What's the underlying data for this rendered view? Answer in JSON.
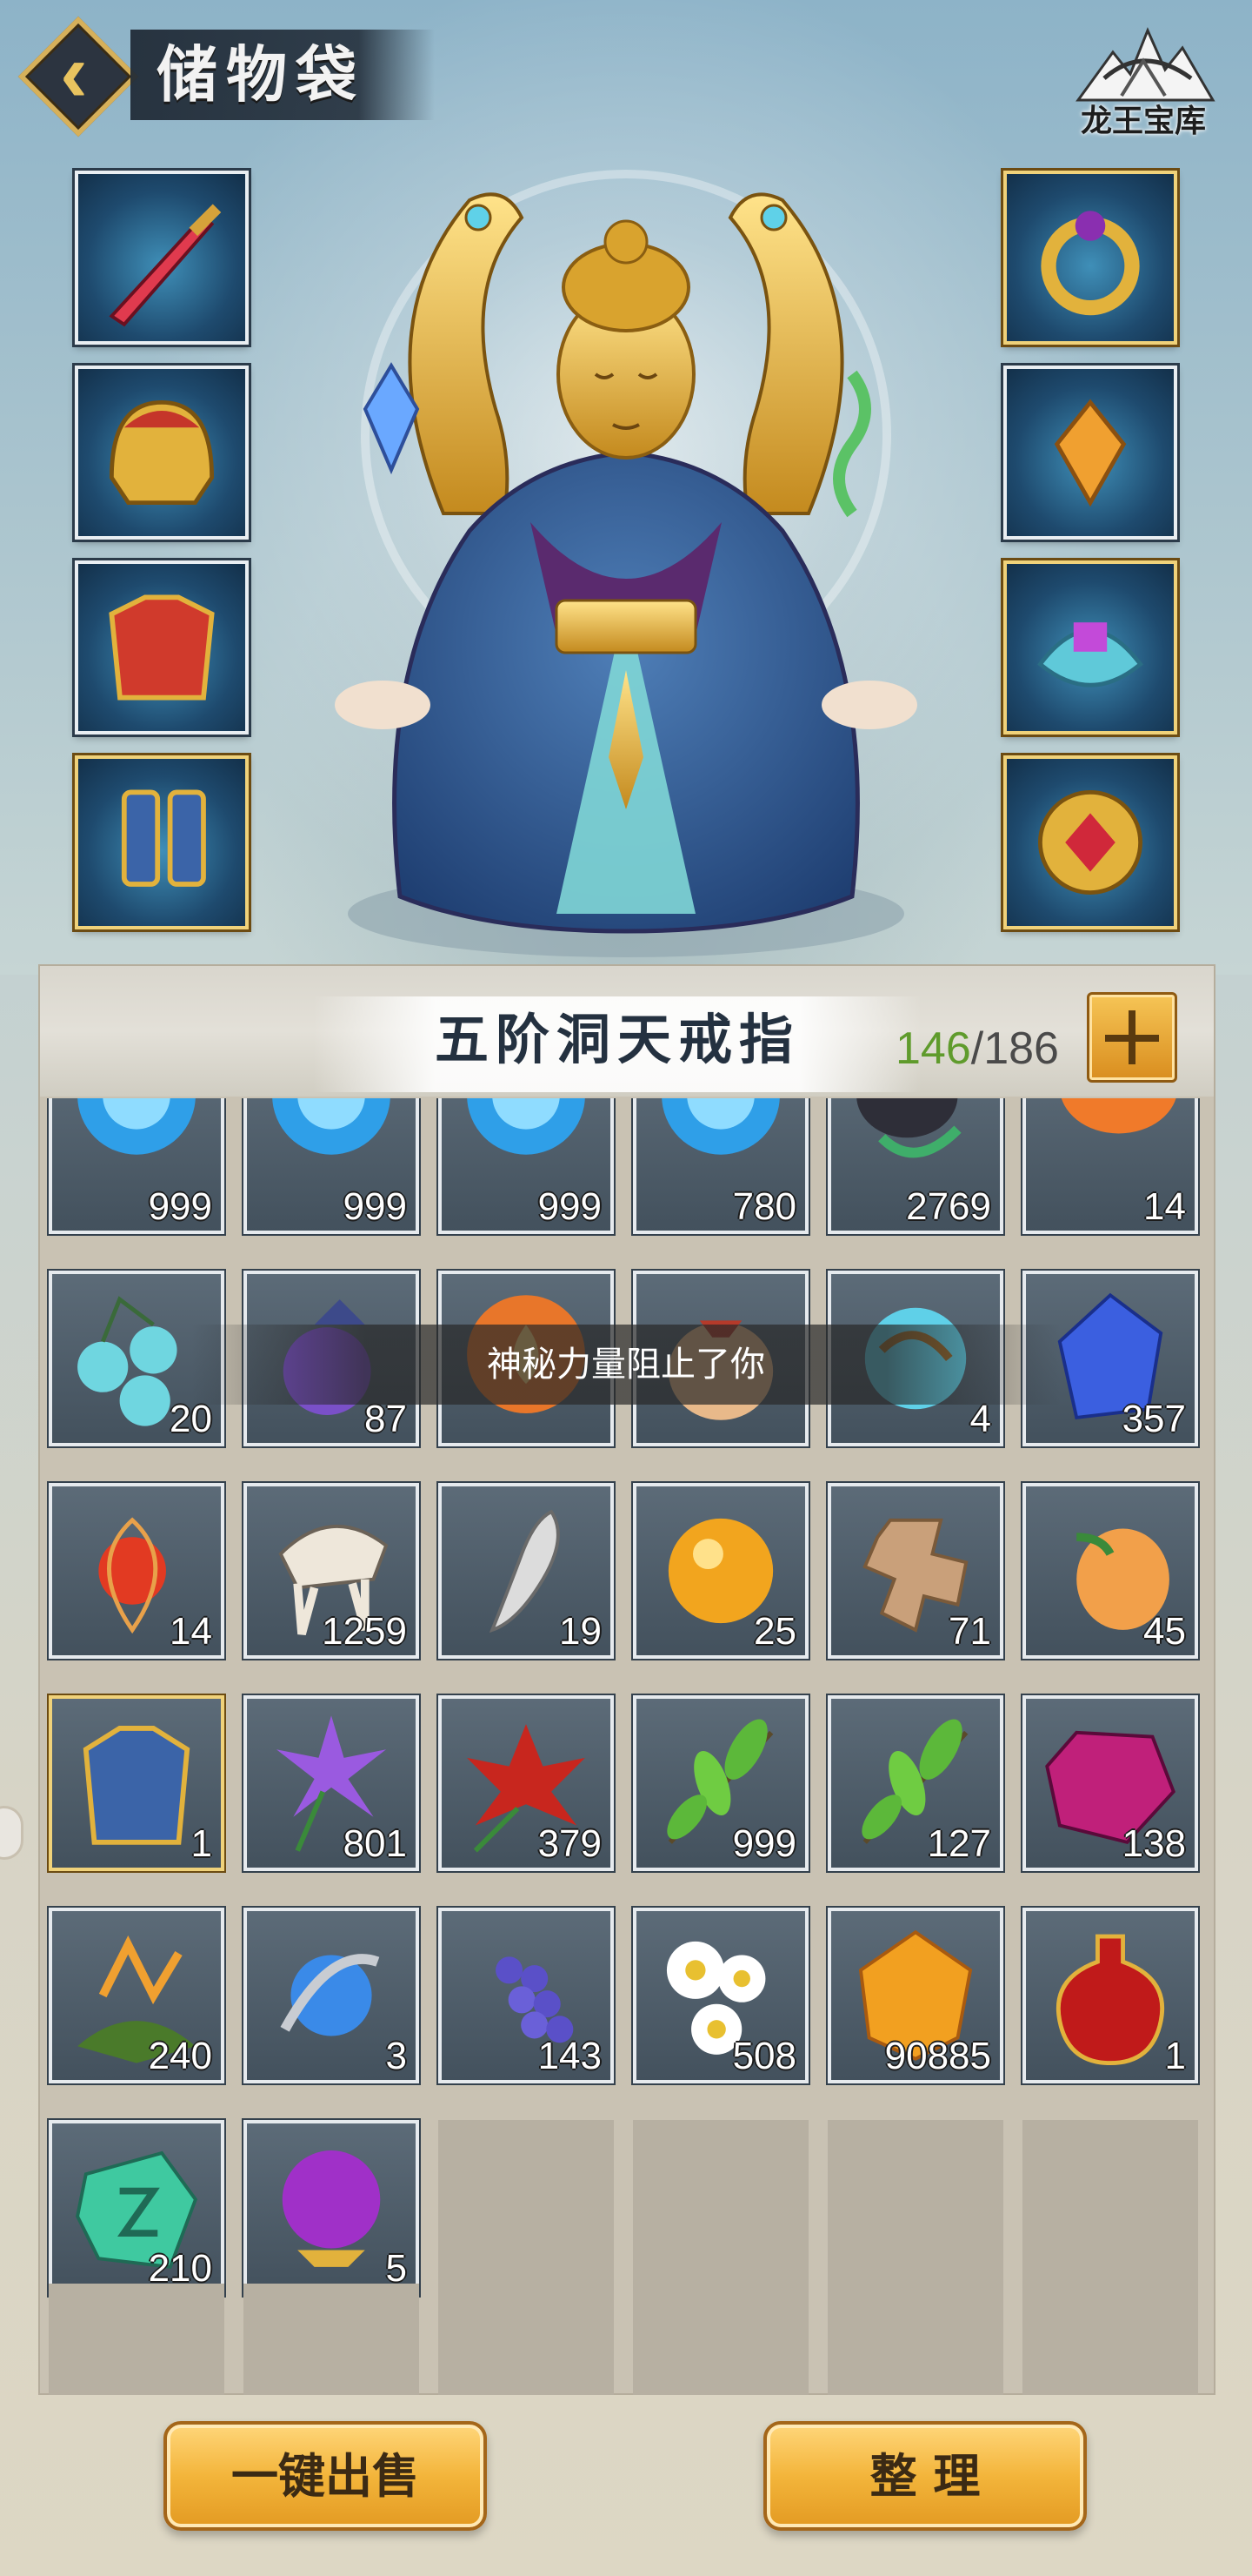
{
  "header": {
    "title": "储物袋",
    "treasury_label": "龙王宝库"
  },
  "bag": {
    "ring_name": "五阶洞天戒指",
    "capacity_used": "146",
    "capacity_sep": "/",
    "capacity_total": "186"
  },
  "toast": "神秘力量阻止了你",
  "grid": {
    "rows": [
      [
        {
          "icon": "blue-orb-icon",
          "count": "999"
        },
        {
          "icon": "blue-orb-icon",
          "count": "999"
        },
        {
          "icon": "blue-orb-icon",
          "count": "999"
        },
        {
          "icon": "blue-orb-icon",
          "count": "780"
        },
        {
          "icon": "dark-pouch-icon",
          "count": "2769"
        },
        {
          "icon": "orange-fruit-icon",
          "count": "14"
        }
      ],
      [
        {
          "icon": "teal-berries-icon",
          "count": "20"
        },
        {
          "icon": "purple-fruit-icon",
          "count": "87"
        },
        {
          "icon": "fire-orb-icon",
          "count": ""
        },
        {
          "icon": "treasure-bag-icon",
          "count": ""
        },
        {
          "icon": "spirit-egg-icon",
          "count": "4"
        },
        {
          "icon": "blue-crystal-icon",
          "count": "357"
        }
      ],
      [
        {
          "icon": "red-lantern-fruit-icon",
          "count": "14"
        },
        {
          "icon": "beast-skull-icon",
          "count": "1259"
        },
        {
          "icon": "fang-icon",
          "count": "19"
        },
        {
          "icon": "golden-pearl-icon",
          "count": "25"
        },
        {
          "icon": "wooden-cross-icon",
          "count": "71"
        },
        {
          "icon": "peach-icon",
          "count": "45"
        }
      ],
      [
        {
          "icon": "armor-chest-icon",
          "count": "1",
          "gold": true
        },
        {
          "icon": "purple-flower-icon",
          "count": "801"
        },
        {
          "icon": "red-lotus-icon",
          "count": "379"
        },
        {
          "icon": "green-herb-icon",
          "count": "999"
        },
        {
          "icon": "green-herb-icon",
          "count": "127"
        },
        {
          "icon": "magenta-gem-icon",
          "count": "138"
        }
      ],
      [
        {
          "icon": "orange-lily-icon",
          "count": "240"
        },
        {
          "icon": "blue-bead-icon",
          "count": "3"
        },
        {
          "icon": "grape-berries-icon",
          "count": "143"
        },
        {
          "icon": "white-daisy-icon",
          "count": "508"
        },
        {
          "icon": "amber-crystal-icon",
          "count": "90885"
        },
        {
          "icon": "red-potion-icon",
          "count": "1"
        }
      ],
      [
        {
          "icon": "jade-rune-stone-icon",
          "count": "210"
        },
        {
          "icon": "purple-spirit-orb-icon",
          "count": "5"
        },
        null,
        null,
        null,
        null
      ],
      [
        null,
        null,
        null,
        null,
        null,
        null
      ]
    ]
  },
  "equipment": {
    "left": [
      "sword-icon",
      "helmet-icon",
      "chest-armor-icon",
      "boots-icon"
    ],
    "right": [
      "ring-icon",
      "pendant-icon",
      "bracer-icon",
      "amulet-icon"
    ]
  },
  "buttons": {
    "sell_all": "一键出售",
    "sort": "整 理"
  },
  "colors": {
    "capacity_used": "#5f9b2c",
    "button_gold": "#f3b53b"
  }
}
